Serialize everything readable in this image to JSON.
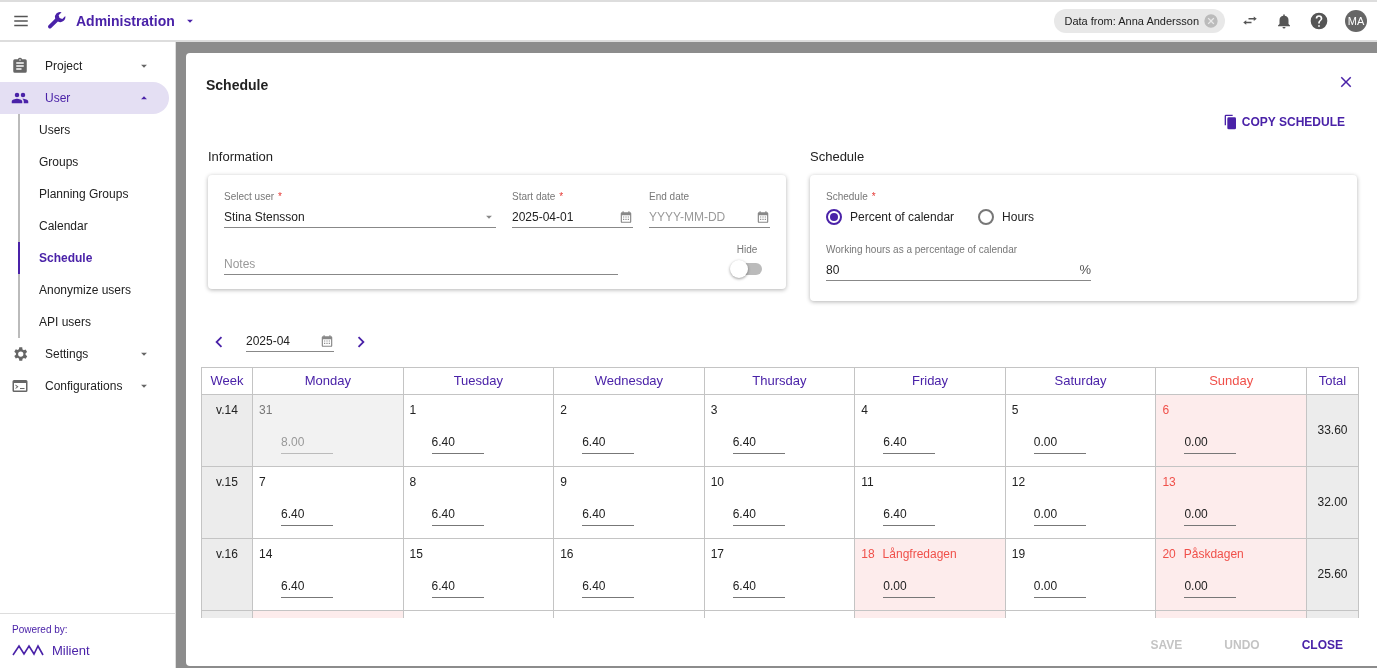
{
  "app_bar": {
    "title": "Administration",
    "data_from": "Data from: Anna Andersson",
    "avatar": "MA"
  },
  "sidebar": {
    "items": [
      {
        "label": "Project",
        "expanded": false,
        "selected": false
      },
      {
        "label": "User",
        "expanded": true,
        "selected": true,
        "children": [
          {
            "label": "Users",
            "selected": false
          },
          {
            "label": "Groups",
            "selected": false
          },
          {
            "label": "Planning Groups",
            "selected": false
          },
          {
            "label": "Calendar",
            "selected": false
          },
          {
            "label": "Schedule",
            "selected": true
          },
          {
            "label": "Anonymize users",
            "selected": false
          },
          {
            "label": "API users",
            "selected": false
          }
        ]
      },
      {
        "label": "Settings",
        "expanded": false,
        "selected": false
      },
      {
        "label": "Configurations",
        "expanded": false,
        "selected": false
      }
    ],
    "footer": {
      "powered_by": "Powered by:",
      "brand": "Milient"
    }
  },
  "dialog": {
    "title": "Schedule",
    "copy_button": "COPY SCHEDULE",
    "information": {
      "heading": "Information",
      "select_user": {
        "label": "Select user",
        "required_mark": "*",
        "value": "Stina Stensson"
      },
      "start_date": {
        "label": "Start date",
        "required_mark": "*",
        "value": "2025-04-01"
      },
      "end_date": {
        "label": "End date",
        "placeholder": "YYYY-MM-DD"
      },
      "notes": {
        "placeholder": "Notes"
      },
      "hide": {
        "label": "Hide",
        "on": false
      }
    },
    "schedule": {
      "heading": "Schedule",
      "type_label": "Schedule",
      "required_mark": "*",
      "options": [
        {
          "label": "Percent of calendar",
          "selected": true
        },
        {
          "label": "Hours",
          "selected": false
        }
      ],
      "percent_label": "Working hours as a percentage of calendar",
      "percent_value": "80",
      "unit": "%"
    },
    "month": "2025-04",
    "calendar": {
      "week_header": "Week",
      "total_header": "Total",
      "columns": [
        {
          "label": "Monday",
          "holiday": false
        },
        {
          "label": "Tuesday",
          "holiday": false
        },
        {
          "label": "Wednesday",
          "holiday": false
        },
        {
          "label": "Thursday",
          "holiday": false
        },
        {
          "label": "Friday",
          "holiday": false
        },
        {
          "label": "Saturday",
          "holiday": false
        },
        {
          "label": "Sunday",
          "holiday": true
        }
      ],
      "weeks": [
        {
          "week": "v.14",
          "total": "33.60",
          "days": [
            {
              "date": "31",
              "value": "8.00",
              "kind": "outside"
            },
            {
              "date": "1",
              "value": "6.40",
              "kind": "normal"
            },
            {
              "date": "2",
              "value": "6.40",
              "kind": "normal"
            },
            {
              "date": "3",
              "value": "6.40",
              "kind": "normal"
            },
            {
              "date": "4",
              "value": "6.40",
              "kind": "normal"
            },
            {
              "date": "5",
              "value": "0.00",
              "kind": "normal"
            },
            {
              "date": "6",
              "value": "0.00",
              "kind": "holiday"
            }
          ]
        },
        {
          "week": "v.15",
          "total": "32.00",
          "days": [
            {
              "date": "7",
              "value": "6.40",
              "kind": "normal"
            },
            {
              "date": "8",
              "value": "6.40",
              "kind": "normal"
            },
            {
              "date": "9",
              "value": "6.40",
              "kind": "normal"
            },
            {
              "date": "10",
              "value": "6.40",
              "kind": "normal"
            },
            {
              "date": "11",
              "value": "6.40",
              "kind": "normal"
            },
            {
              "date": "12",
              "value": "0.00",
              "kind": "normal"
            },
            {
              "date": "13",
              "value": "0.00",
              "kind": "holiday"
            }
          ]
        },
        {
          "week": "v.16",
          "total": "25.60",
          "days": [
            {
              "date": "14",
              "value": "6.40",
              "kind": "normal"
            },
            {
              "date": "15",
              "value": "6.40",
              "kind": "normal"
            },
            {
              "date": "16",
              "value": "6.40",
              "kind": "normal"
            },
            {
              "date": "17",
              "value": "6.40",
              "kind": "normal"
            },
            {
              "date": "18",
              "name": "Långfredagen",
              "value": "0.00",
              "kind": "holiday"
            },
            {
              "date": "19",
              "value": "0.00",
              "kind": "normal"
            },
            {
              "date": "20",
              "name": "Påskdagen",
              "value": "0.00",
              "kind": "holiday"
            }
          ]
        },
        {
          "days": [
            {
              "kind": "holiday"
            },
            {
              "kind": "normal"
            },
            {
              "kind": "normal"
            },
            {
              "kind": "normal"
            },
            {
              "kind": "holiday"
            },
            {
              "kind": "normal"
            },
            {
              "kind": "holiday"
            }
          ]
        }
      ]
    },
    "footer_buttons": [
      {
        "label": "SAVE",
        "disabled": true
      },
      {
        "label": "UNDO",
        "disabled": true
      },
      {
        "label": "CLOSE",
        "disabled": false
      }
    ]
  }
}
